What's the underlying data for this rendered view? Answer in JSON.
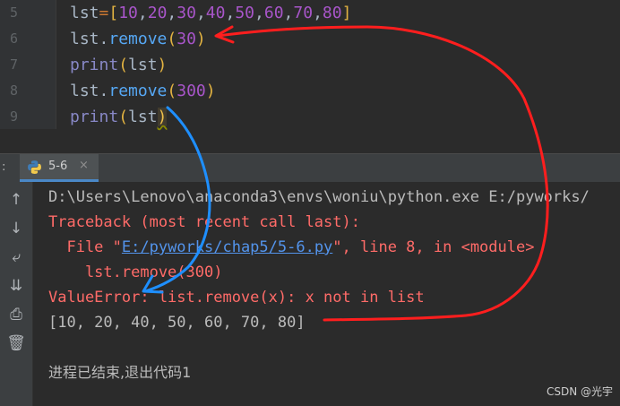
{
  "editor": {
    "lines": [
      {
        "num": "5",
        "parts": [
          {
            "t": "lst",
            "c": ""
          },
          {
            "t": "=",
            "c": "op"
          },
          {
            "t": "[",
            "c": "br"
          },
          {
            "t": "10",
            "c": "num"
          },
          {
            "t": ",",
            "c": ""
          },
          {
            "t": "20",
            "c": "num"
          },
          {
            "t": ",",
            "c": ""
          },
          {
            "t": "30",
            "c": "num"
          },
          {
            "t": ",",
            "c": ""
          },
          {
            "t": "40",
            "c": "num"
          },
          {
            "t": ",",
            "c": ""
          },
          {
            "t": "50",
            "c": "num"
          },
          {
            "t": ",",
            "c": ""
          },
          {
            "t": "60",
            "c": "num"
          },
          {
            "t": ",",
            "c": ""
          },
          {
            "t": "70",
            "c": "num"
          },
          {
            "t": ",",
            "c": ""
          },
          {
            "t": "80",
            "c": "num"
          },
          {
            "t": "]",
            "c": "br"
          }
        ]
      },
      {
        "num": "6",
        "parts": [
          {
            "t": "lst.",
            "c": ""
          },
          {
            "t": "remove",
            "c": "fn"
          },
          {
            "t": "(",
            "c": "br"
          },
          {
            "t": "30",
            "c": "num"
          },
          {
            "t": ")",
            "c": "br"
          }
        ]
      },
      {
        "num": "7",
        "parts": [
          {
            "t": "print",
            "c": "kw"
          },
          {
            "t": "(",
            "c": "br"
          },
          {
            "t": "lst",
            "c": ""
          },
          {
            "t": ")",
            "c": "br"
          }
        ]
      },
      {
        "num": "8",
        "parts": [
          {
            "t": "lst.",
            "c": ""
          },
          {
            "t": "remove",
            "c": "fn"
          },
          {
            "t": "(",
            "c": "br"
          },
          {
            "t": "300",
            "c": "num"
          },
          {
            "t": ")",
            "c": "br"
          }
        ]
      },
      {
        "num": "9",
        "parts": [
          {
            "t": "print",
            "c": "kw"
          },
          {
            "t": "(",
            "c": "br"
          },
          {
            "t": "lst",
            "c": ""
          },
          {
            "t": ")",
            "c": "err-br squig"
          }
        ]
      }
    ]
  },
  "run_panel": {
    "tab_prefix": ":",
    "tab_label": "5-6",
    "tab_close": "×",
    "tools": [
      "↑",
      "↓",
      "⤶",
      "⇊",
      "⎙",
      "🗑"
    ],
    "console": {
      "cmd": "D:\\Users\\Lenovo\\anaconda3\\envs\\woniu\\python.exe E:/pyworks/",
      "traceback": "Traceback (most recent call last):",
      "file_prefix": "  File \"",
      "file_link": "E:/pyworks/chap5/5-6.py",
      "file_suffix": "\", line 8, in <module>",
      "code_line": "    lst.remove(300)",
      "error": "ValueError: list.remove(x): x not in list",
      "output": "[10, 20, 40, 50, 60, 70, 80]",
      "exit": "进程已结束,退出代码1"
    }
  },
  "watermark": "CSDN @光宇",
  "colors": {
    "annotation_red": "#ff1e1e",
    "annotation_blue": "#1e8fff"
  }
}
